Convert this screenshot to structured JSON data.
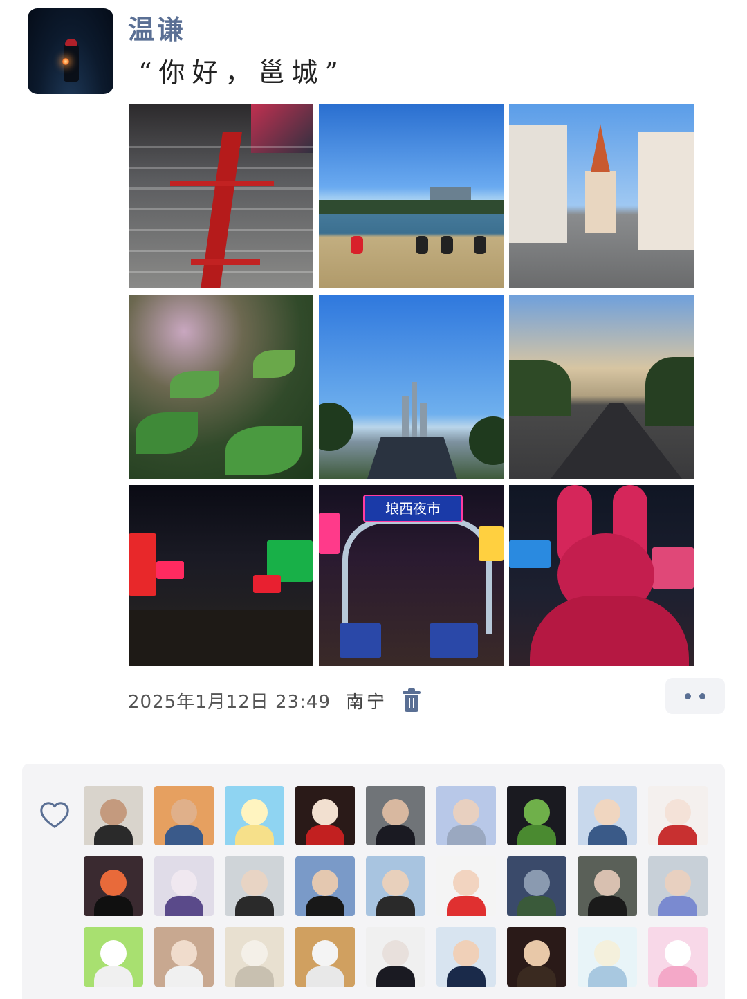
{
  "post": {
    "username": "温谦",
    "caption": "“你好，邕城”",
    "timestamp": "2025年1月12日 23:49",
    "location": "南宁",
    "photos": [
      {
        "icon": "stairs-photo"
      },
      {
        "icon": "lake-photo"
      },
      {
        "icon": "church-street-photo"
      },
      {
        "icon": "garden-photo"
      },
      {
        "icon": "skyline-photo"
      },
      {
        "icon": "highway-photo"
      },
      {
        "icon": "night-street-photo"
      },
      {
        "icon": "night-market-photo",
        "sign_text": "埌西夜市"
      },
      {
        "icon": "pink-bunny-photo"
      }
    ]
  },
  "likes": {
    "icon": "heart-icon",
    "avatars": [
      {
        "bg": "#d9d4cc",
        "face": "#c49a7e",
        "body": "#2a2a2a"
      },
      {
        "bg": "#e6a060",
        "face": "#e0b08a",
        "body": "#3a5a8a"
      },
      {
        "bg": "#8fd4f2",
        "face": "#fff4c0",
        "body": "#f6e08a"
      },
      {
        "bg": "#2a1a18",
        "face": "#f2e0d0",
        "body": "#c22020"
      },
      {
        "bg": "#707478",
        "face": "#d8b8a0",
        "body": "#1a1a22"
      },
      {
        "bg": "#b8c8e8",
        "face": "#e8d0c0",
        "body": "#9aa8c0"
      },
      {
        "bg": "#1a1a20",
        "face": "#6fb04a",
        "body": "#4a8a30"
      },
      {
        "bg": "#c8d8ec",
        "face": "#f0d6c0",
        "body": "#3a5a88"
      },
      {
        "bg": "#f4f0ee",
        "face": "#f4e2d8",
        "body": "#c83030"
      },
      {
        "bg": "#3a2a30",
        "face": "#e86a3a",
        "body": "#101010"
      },
      {
        "bg": "#e0dce8",
        "face": "#f0e8f0",
        "body": "#5a4a8a"
      },
      {
        "bg": "#cfd4d8",
        "face": "#e8d4c4",
        "body": "#2a2a2a"
      },
      {
        "bg": "#7a9ac8",
        "face": "#e4c8b0",
        "body": "#181818"
      },
      {
        "bg": "#a8c4e0",
        "face": "#e8d0bc",
        "body": "#2a2a2a"
      },
      {
        "bg": "#f4f4f4",
        "face": "#f2d4c0",
        "body": "#e03030"
      },
      {
        "bg": "#3a4a6a",
        "face": "#8a9ab0",
        "body": "#3a5a3a"
      },
      {
        "bg": "#5a6058",
        "face": "#d8c0b0",
        "body": "#1a1a1a"
      },
      {
        "bg": "#c8d0d8",
        "face": "#e8d0c0",
        "body": "#7a8ad0"
      },
      {
        "bg": "#a8e070",
        "face": "#ffffff",
        "body": "#f0f0f0"
      },
      {
        "bg": "#c8a890",
        "face": "#f0dccc",
        "body": "#f0f0f0"
      },
      {
        "bg": "#e8e0d0",
        "face": "#f4f0e8",
        "body": "#c8c0b0"
      },
      {
        "bg": "#d0a060",
        "face": "#f4f4f4",
        "body": "#e8e8e8"
      },
      {
        "bg": "#f0f0f0",
        "face": "#e8e0dc",
        "body": "#1a1a22"
      },
      {
        "bg": "#d8e4f0",
        "face": "#f0d0b8",
        "body": "#1a2a4a"
      },
      {
        "bg": "#2a1a18",
        "face": "#e8c8a8",
        "body": "#3a2a20"
      },
      {
        "bg": "#e8f4f8",
        "face": "#f4f0dc",
        "body": "#a8c8e0"
      },
      {
        "bg": "#f8d8e8",
        "face": "#ffffff",
        "body": "#f4a8c8"
      }
    ]
  },
  "colors": {
    "username": "#5a6f94",
    "accent": "#5a6f94"
  }
}
